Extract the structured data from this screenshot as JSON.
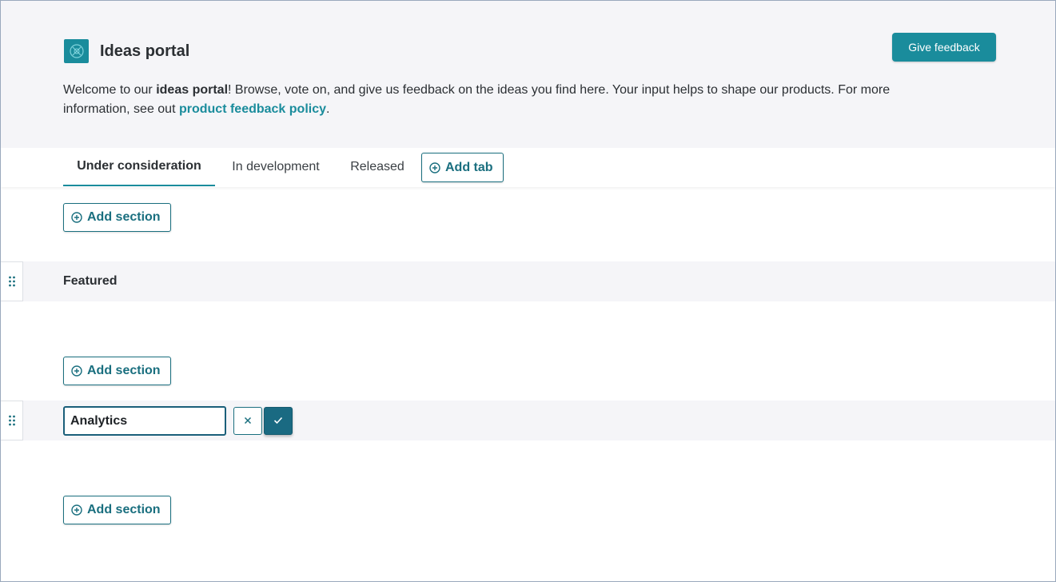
{
  "header": {
    "title": "Ideas portal",
    "give_feedback_label": "Give feedback",
    "welcome": {
      "prefix": "Welcome to our ",
      "bold": "ideas portal",
      "middle": "! Browse, vote on, and give us feedback on the ideas you find here. Your input helps to shape our products. For more information, see out ",
      "link": "product feedback policy",
      "suffix": "."
    }
  },
  "tabs": [
    {
      "label": "Under consideration",
      "active": true
    },
    {
      "label": "In development",
      "active": false
    },
    {
      "label": "Released",
      "active": false
    }
  ],
  "add_tab_label": "Add tab",
  "add_section_label": "Add section",
  "sections": {
    "featured": {
      "title": "Featured"
    },
    "analytics": {
      "input_value": "Analytics"
    }
  },
  "colors": {
    "accent": "#1a8c9c",
    "accent_dark": "#1a6a82",
    "header_bg": "#f5f5f8"
  },
  "icons": {
    "logo": "portal-logo-icon",
    "add": "plus-circle-icon",
    "drag": "drag-handle-icon",
    "cancel": "close-icon",
    "confirm": "check-icon"
  }
}
